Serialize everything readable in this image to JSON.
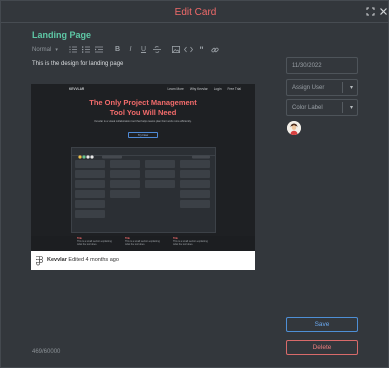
{
  "dialog": {
    "title": "Edit Card",
    "expand_icon": "expand-icon",
    "close_icon": "close-icon"
  },
  "card": {
    "title": "Landing Page",
    "description": "This is the design for landing page",
    "char_count": "469/60000"
  },
  "toolbar": {
    "style_select": "Normal",
    "buttons": [
      "ordered-list-icon",
      "bullet-list-icon",
      "indent-icon",
      "bold-icon",
      "italic-icon",
      "underline-icon",
      "strikethrough-icon",
      "image-icon",
      "code-icon",
      "quote-icon",
      "link-icon"
    ]
  },
  "attachment": {
    "preview": {
      "brand": "KEVVLAR",
      "nav_links": [
        "Learn More",
        "Why Kevvlar",
        "Login",
        "Free Trial"
      ],
      "headline_1": "The Only Project Management",
      "headline_2": "Tool You Will Need",
      "subtext": "Kevvlar is a visual collaboration tool that helps teams plan their work more efficiently.",
      "cta": "Try Now",
      "features": [
        {
          "title": "Title",
          "text": "This is a small section explaining what the tool does."
        },
        {
          "title": "Title",
          "text": "This is a small section explaining what the tool does."
        },
        {
          "title": "Title",
          "text": "This is a small section explaining what the tool does."
        }
      ]
    },
    "source_name": "Kevvlar",
    "edited": "Edited 4 months ago"
  },
  "sidebar": {
    "date": "11/30/2022",
    "assign_user": "Assign User",
    "color_label": "Color Label"
  },
  "actions": {
    "save": "Save",
    "delete": "Delete"
  },
  "colors": {
    "title_accent": "#f06a6a",
    "card_title": "#5ec8a6",
    "save": "#4e8fd6",
    "delete": "#d86a6a",
    "background": "#33373c"
  }
}
